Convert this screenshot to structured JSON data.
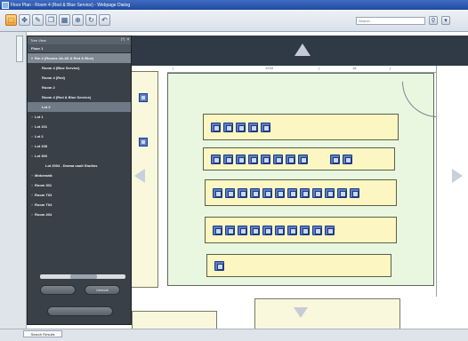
{
  "window": {
    "title": "Floor Plan - Room 4 (Red & Blue Service) - Webpage Dialog"
  },
  "toolbar": {
    "buttons": [
      {
        "icon": "select-icon",
        "glyph": "⬚",
        "active": true
      },
      {
        "icon": "pan-icon",
        "glyph": "✥"
      },
      {
        "icon": "draw-icon",
        "glyph": "✎"
      },
      {
        "icon": "copy-icon",
        "glyph": "❐"
      },
      {
        "icon": "table-icon",
        "glyph": "▦"
      },
      {
        "icon": "zoom-icon",
        "glyph": "⊕"
      },
      {
        "icon": "rotate-icon",
        "glyph": "↻"
      },
      {
        "icon": "undo-icon",
        "glyph": "↶"
      }
    ],
    "search_placeholder": "Search",
    "search_button_glyph": "⚲",
    "menu_glyph": "▾"
  },
  "tree": {
    "header": "Tree View",
    "pin_glyph": "⊓",
    "close_glyph": "×",
    "floor": "Floor 1",
    "items": [
      {
        "label": "Rm 4 (Rooms 4A-4D & Red & Blue)",
        "expander": "▾",
        "state": "top-sel"
      },
      {
        "label": "Room 4 (Blue Service)",
        "expander": ""
      },
      {
        "label": "Room 4 (Red)",
        "expander": ""
      },
      {
        "label": "Room 2",
        "expander": ""
      },
      {
        "label": "Room 4 (Red & Blue Service)",
        "expander": ""
      },
      {
        "label": "Lot 2",
        "expander": "",
        "state": "selected"
      },
      {
        "label": "Lot 1",
        "expander": "›"
      },
      {
        "label": "Lot 101",
        "expander": "›"
      },
      {
        "label": "Lot 2",
        "expander": "›"
      },
      {
        "label": "Lot 108",
        "expander": "›"
      },
      {
        "label": "Lot 300",
        "expander": "›"
      },
      {
        "label": "Lot 2004 - Drama vault Studios",
        "expander": ""
      },
      {
        "label": "Motorwalk",
        "expander": "›"
      },
      {
        "label": "Room 301",
        "expander": "›"
      },
      {
        "label": "Room T03",
        "expander": "›"
      },
      {
        "label": "Room T04",
        "expander": "›"
      },
      {
        "label": "Room 204",
        "expander": "›"
      }
    ],
    "button_left": "",
    "button_right": "Unbook",
    "button_bottom": ""
  },
  "map": {
    "ruler_labels": [
      "|",
      "1218",
      "|",
      "18",
      "|"
    ],
    "benches": [
      {
        "seats": 5
      },
      {
        "seats": 8,
        "extra_seats": 2
      },
      {
        "seats": 12
      },
      {
        "seats": 10
      },
      {
        "seats": 1
      }
    ]
  },
  "bottom": {
    "tab_label": "Search Results"
  },
  "colors": {
    "room_fill": "#e9f7e0",
    "bench_fill": "#fbf6c2",
    "seat_fill": "#5d7ec7",
    "panel_dark": "#3a4047",
    "titlebar": "#2a58ae"
  }
}
